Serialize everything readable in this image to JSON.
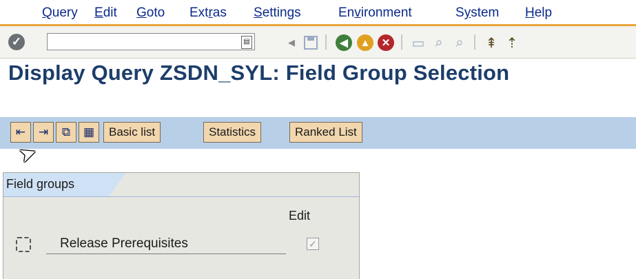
{
  "menu": {
    "items": [
      {
        "pre": "",
        "u": "Q",
        "post": "uery"
      },
      {
        "pre": "",
        "u": "E",
        "post": "dit"
      },
      {
        "pre": "",
        "u": "G",
        "post": "oto"
      },
      {
        "pre": "Ext",
        "u": "r",
        "post": "as"
      },
      {
        "pre": "",
        "u": "S",
        "post": "ettings"
      },
      {
        "pre": "En",
        "u": "v",
        "post": "ironment"
      },
      {
        "pre": "S",
        "u": "y",
        "post": "stem"
      },
      {
        "pre": "",
        "u": "H",
        "post": "elp"
      }
    ]
  },
  "system_toolbar": {
    "command_field_value": "",
    "ok_glyph": "✓",
    "back_glyph": "◀",
    "icons": [
      "save-icon",
      "back-icon",
      "exit-icon",
      "cancel-icon",
      "print-icon",
      "find-icon",
      "find-next-icon",
      "first-page-icon",
      "previous-page-icon"
    ]
  },
  "title": "Display Query ZSDN_SYL: Field Group Selection",
  "app_toolbar": {
    "buttons": [
      "Basic list",
      "Statistics",
      "Ranked List"
    ]
  },
  "field_groups": {
    "tab_label": "Field groups",
    "edit_header": "Edit",
    "rows": [
      {
        "label": "Release Prerequisites",
        "edit_checked": true
      }
    ]
  },
  "colors": {
    "title": "#1c3d6b",
    "menu_text": "#0a2a8a",
    "app_toolbar": "#b8cfe8",
    "button_bg": "#f1d6ae",
    "accent_line": "#e8a33a"
  }
}
